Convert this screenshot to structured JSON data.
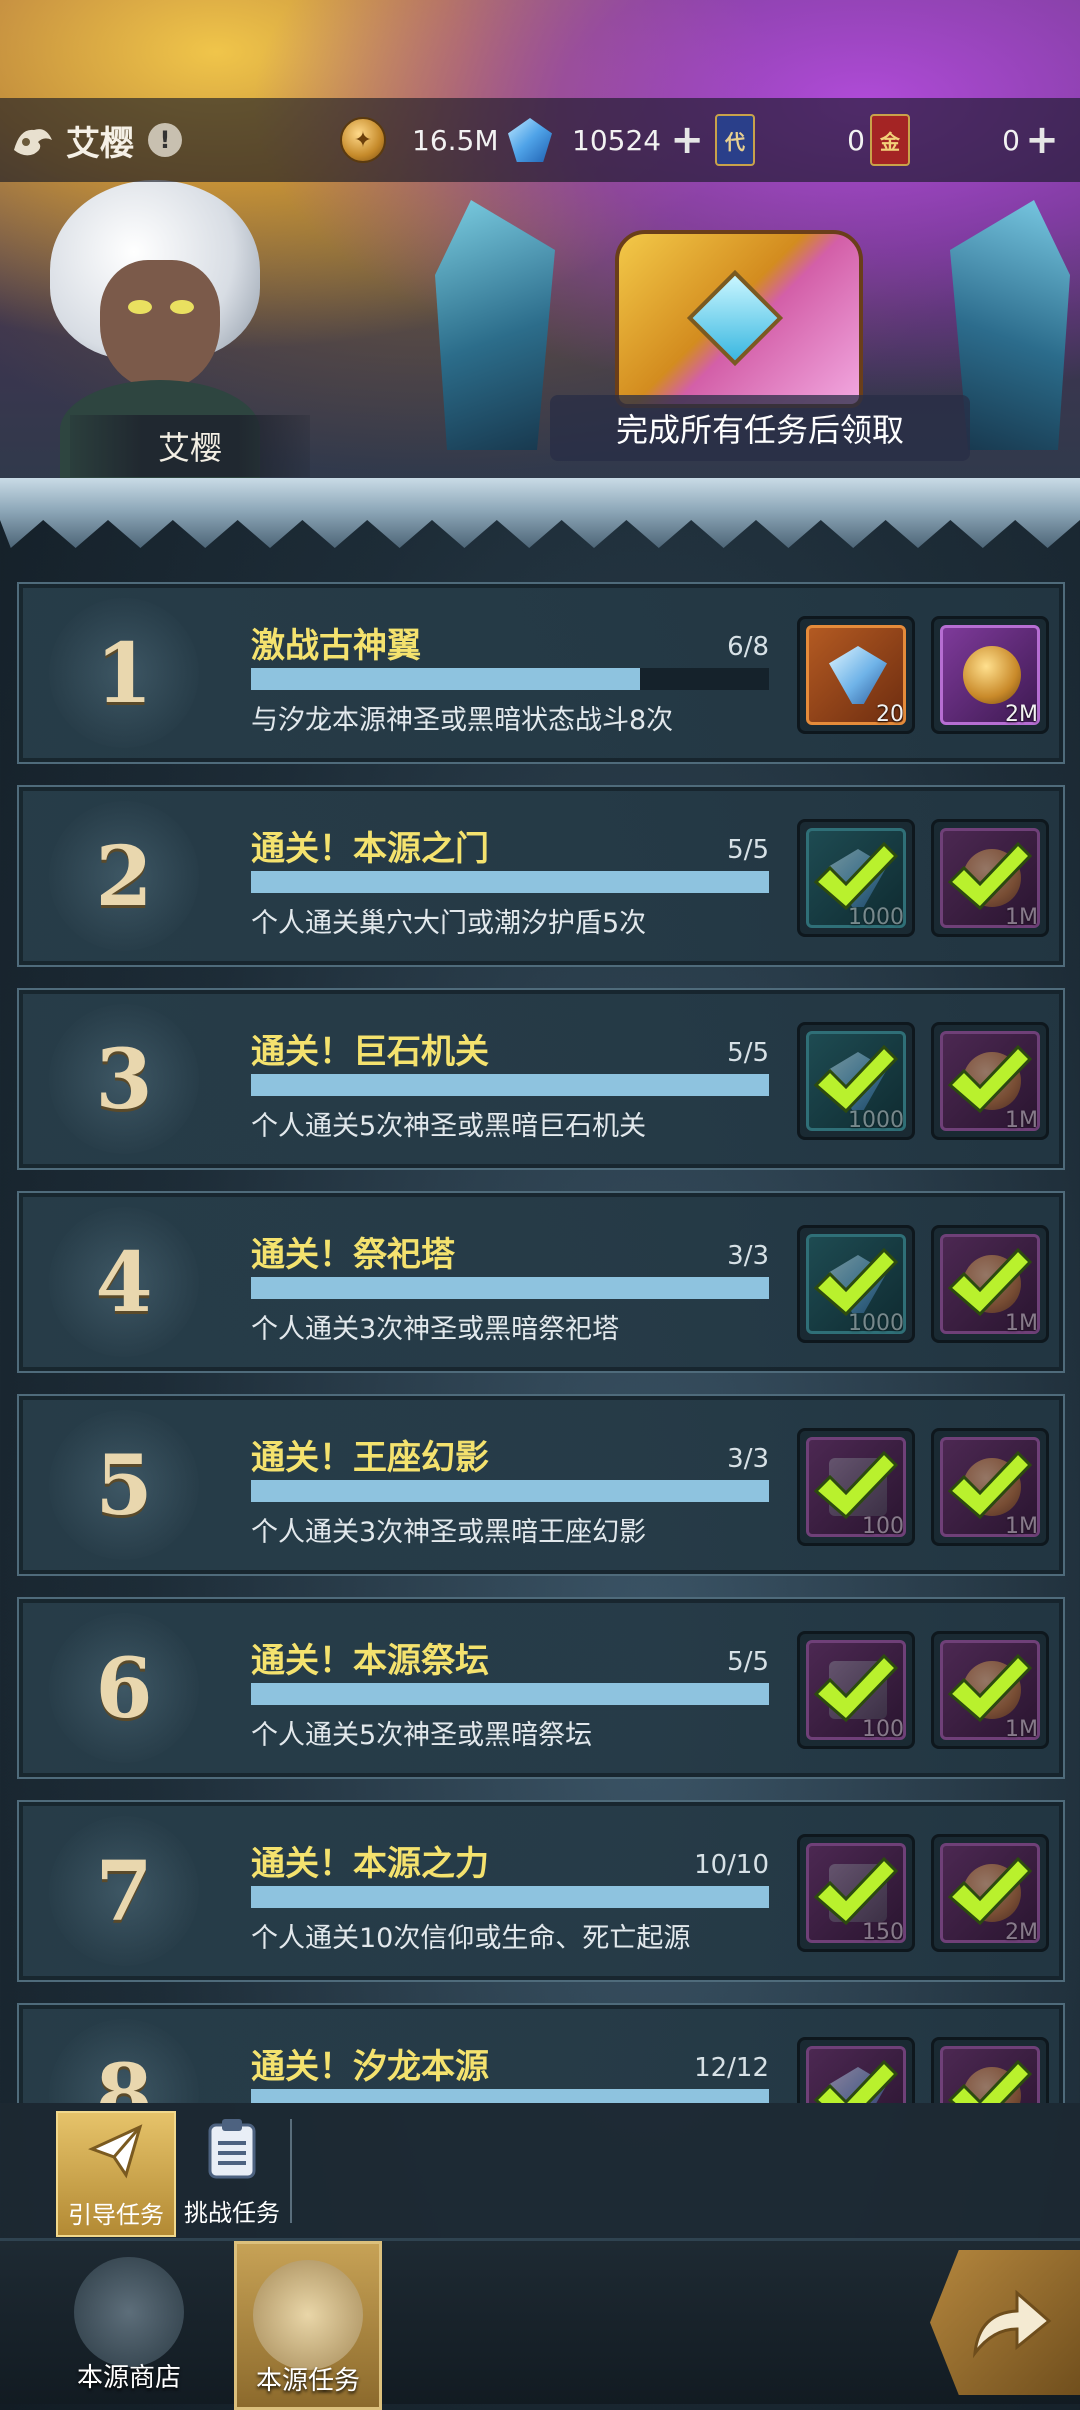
{
  "header": {
    "hero_name": "艾樱",
    "warn_glyph": "!",
    "gold": "16.5M",
    "diamonds": "10524",
    "card_a_glyph": "代",
    "card_a_count": "0",
    "card_b_glyph": "金",
    "card_b_count": "0"
  },
  "banner": {
    "portrait_label": "艾樱",
    "reward_label": "完成所有任务后领取"
  },
  "tasks": [
    {
      "num": "1",
      "title": "激战古神翼",
      "progress": "6/8",
      "fill": 0.75,
      "desc": "与汐龙本源神圣或黑暗状态战斗8次",
      "r1": {
        "qty": "20",
        "frame": "orange",
        "item": "shard",
        "done": false
      },
      "r2": {
        "qty": "2M",
        "frame": "purple",
        "item": "coinsh",
        "done": false
      }
    },
    {
      "num": "2",
      "title": "通关！本源之门",
      "progress": "5/5",
      "fill": 1.0,
      "desc": "个人通关巢穴大门或潮汐护盾5次",
      "r1": {
        "qty": "1000",
        "frame": "teal",
        "item": "shard",
        "done": true
      },
      "r2": {
        "qty": "1M",
        "frame": "dpurple",
        "item": "coinsh",
        "done": true
      }
    },
    {
      "num": "3",
      "title": "通关！巨石机关",
      "progress": "5/5",
      "fill": 1.0,
      "desc": "个人通关5次神圣或黑暗巨石机关",
      "r1": {
        "qty": "1000",
        "frame": "teal",
        "item": "shard",
        "done": true
      },
      "r2": {
        "qty": "1M",
        "frame": "dpurple",
        "item": "coinsh",
        "done": true
      }
    },
    {
      "num": "4",
      "title": "通关！祭祀塔",
      "progress": "3/3",
      "fill": 1.0,
      "desc": "个人通关3次神圣或黑暗祭祀塔",
      "r1": {
        "qty": "1000",
        "frame": "teal",
        "item": "shard",
        "done": true
      },
      "r2": {
        "qty": "1M",
        "frame": "dpurple",
        "item": "coinsh",
        "done": true
      }
    },
    {
      "num": "5",
      "title": "通关！王座幻影",
      "progress": "3/3",
      "fill": 1.0,
      "desc": "个人通关3次神圣或黑暗王座幻影",
      "r1": {
        "qty": "100",
        "frame": "dpurple",
        "item": "scroll",
        "done": true
      },
      "r2": {
        "qty": "1M",
        "frame": "dpurple",
        "item": "coinsh",
        "done": true
      }
    },
    {
      "num": "6",
      "title": "通关！本源祭坛",
      "progress": "5/5",
      "fill": 1.0,
      "desc": "个人通关5次神圣或黑暗祭坛",
      "r1": {
        "qty": "100",
        "frame": "dpurple",
        "item": "scroll",
        "done": true
      },
      "r2": {
        "qty": "1M",
        "frame": "dpurple",
        "item": "coinsh",
        "done": true
      }
    },
    {
      "num": "7",
      "title": "通关！本源之力",
      "progress": "10/10",
      "fill": 1.0,
      "desc": "个人通关10次信仰或生命、死亡起源",
      "r1": {
        "qty": "150",
        "frame": "dpurple",
        "item": "scroll",
        "done": true
      },
      "r2": {
        "qty": "2M",
        "frame": "dpurple",
        "item": "coinsh",
        "done": true
      }
    },
    {
      "num": "8",
      "title": "通关！汐龙本源",
      "progress": "12/12",
      "fill": 1.0,
      "desc": "",
      "r1": {
        "qty": "",
        "frame": "dpurple",
        "item": "shard",
        "done": true
      },
      "r2": {
        "qty": "",
        "frame": "dpurple",
        "item": "coinsh",
        "done": true
      }
    }
  ],
  "subtabs": [
    {
      "label": "引导任务",
      "icon": "paper-plane-icon",
      "active": true
    },
    {
      "label": "挑战任务",
      "icon": "clipboard-icon",
      "active": false
    }
  ],
  "nav": [
    {
      "label": "本源商店",
      "icon": "scroll-shop-icon",
      "active": false
    },
    {
      "label": "本源任务",
      "icon": "scroll-quest-icon",
      "active": true
    }
  ],
  "colors": {
    "title_yellow": "#f4e26e",
    "bar_fill": "#8ec3df",
    "check_green": "#b9f12d",
    "gold_accent": "#c7a256"
  }
}
